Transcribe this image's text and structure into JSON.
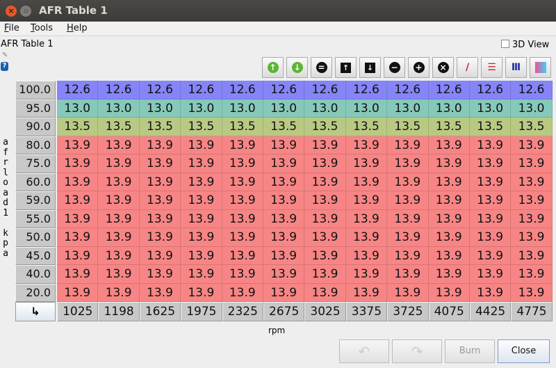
{
  "window": {
    "title": "AFR Table 1"
  },
  "menu": [
    {
      "label": "File",
      "mn": "F",
      "rest": "ile"
    },
    {
      "label": "Tools",
      "mn": "T",
      "rest": "ools"
    },
    {
      "label": "Help",
      "mn": "H",
      "rest": "elp"
    }
  ],
  "panel": {
    "title": "AFR Table 1",
    "view3d_label": "3D View",
    "view3d_checked": false
  },
  "toolbar": [
    "green-up-arrow-icon",
    "green-down-arrow-icon",
    "equals-icon",
    "up-arrow-icon",
    "down-arrow-icon",
    "minus-icon",
    "plus-icon",
    "multiply-icon",
    "pencil-icon",
    "horizontal-interpolate-icon",
    "vertical-interpolate-icon",
    "gradient-icon"
  ],
  "table": {
    "y_axis_label": "afrload1 kpa",
    "x_axis_label": "rpm",
    "row_headers": [
      "100.0",
      "95.0",
      "90.0",
      "80.0",
      "75.0",
      "60.0",
      "59.0",
      "55.0",
      "50.0",
      "45.0",
      "40.0",
      "20.0"
    ],
    "col_headers": [
      "1025",
      "1198",
      "1625",
      "1975",
      "2325",
      "2675",
      "3025",
      "3375",
      "3725",
      "4075",
      "4425",
      "4775"
    ],
    "row_values": [
      "12.6",
      "13.0",
      "13.5",
      "13.9",
      "13.9",
      "13.9",
      "13.9",
      "13.9",
      "13.9",
      "13.9",
      "13.9",
      "13.9"
    ],
    "colors": {
      "12.6": "#8585f7",
      "13.0": "#86c9b9",
      "13.5": "#b9c984",
      "13.9": "#f78585"
    }
  },
  "buttons": {
    "undo": "undo-icon",
    "redo": "redo-icon",
    "burn": "Burn",
    "close": "Close"
  }
}
